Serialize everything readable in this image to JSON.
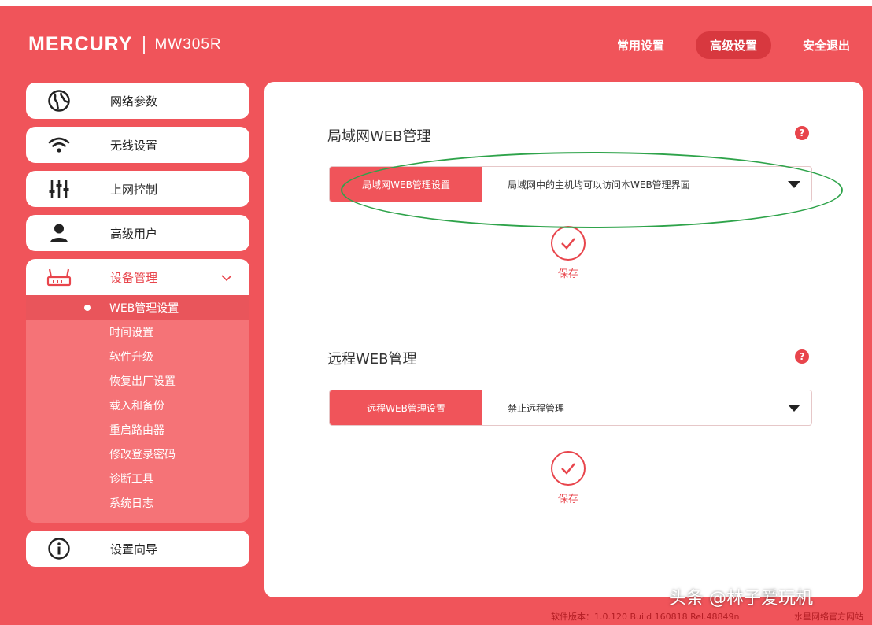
{
  "header": {
    "brand": "MERCURY",
    "model": "MW305R",
    "nav": [
      "常用设置",
      "高级设置",
      "安全退出"
    ],
    "active_nav": 1
  },
  "sidebar": {
    "items": [
      {
        "label": "网络参数",
        "icon": "globe-icon"
      },
      {
        "label": "无线设置",
        "icon": "wifi-icon"
      },
      {
        "label": "上网控制",
        "icon": "sliders-icon"
      },
      {
        "label": "高级用户",
        "icon": "user-icon"
      },
      {
        "label": "设备管理",
        "icon": "router-icon"
      }
    ],
    "submenu": [
      "WEB管理设置",
      "时间设置",
      "软件升级",
      "恢复出厂设置",
      "载入和备份",
      "重启路由器",
      "修改登录密码",
      "诊断工具",
      "系统日志"
    ],
    "active_sub": 0,
    "wizard": {
      "label": "设置向导",
      "icon": "info-icon"
    }
  },
  "lan": {
    "title": "局域网WEB管理",
    "field_label": "局域网WEB管理设置",
    "value": "局域网中的主机均可以访问本WEB管理界面",
    "save": "保存"
  },
  "remote": {
    "title": "远程WEB管理",
    "field_label": "远程WEB管理设置",
    "value": "禁止远程管理",
    "save": "保存"
  },
  "watermark": "头条 @林子爱玩机",
  "footer": {
    "version": "软件版本：1.0.120 Build 160818 Rel.48849n",
    "right": "水星网络官方网站"
  },
  "colors": {
    "brand_red": "#f0545a",
    "active_red": "#d8383f",
    "highlight_green": "#2ea34a"
  }
}
